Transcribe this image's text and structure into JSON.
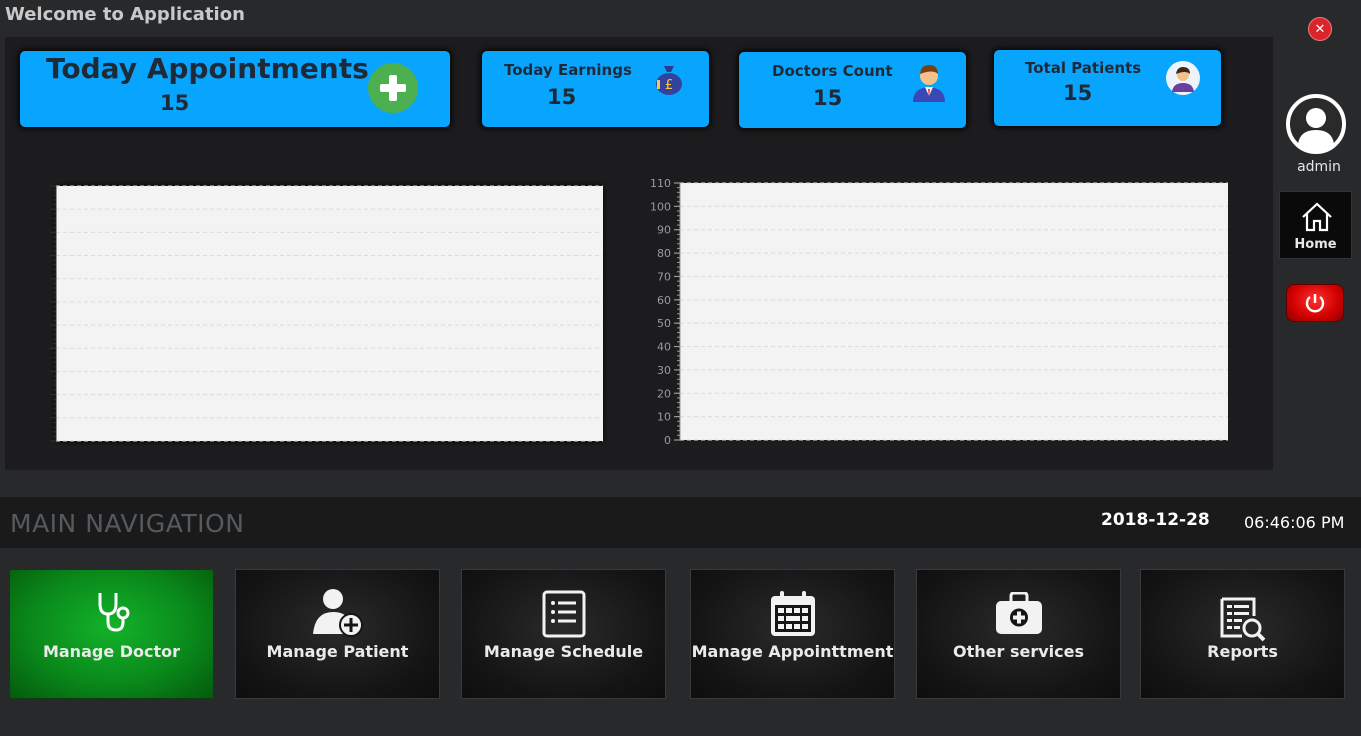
{
  "window": {
    "title": "Welcome to Application"
  },
  "cards": [
    {
      "label": "Today Appointments",
      "value": "15",
      "icon": "add-icon"
    },
    {
      "label": "Today Earnings",
      "value": "15",
      "icon": "money-bag-icon"
    },
    {
      "label": "Doctors Count",
      "value": "15",
      "icon": "doctor-avatar-icon"
    },
    {
      "label": "Total Patients",
      "value": "15",
      "icon": "patient-avatar-icon"
    }
  ],
  "chart_data": [
    {
      "type": "bar",
      "categories": [],
      "values": [],
      "ylim": [
        0,
        110
      ],
      "yticks": [],
      "grid": true
    },
    {
      "type": "bar",
      "categories": [],
      "values": [],
      "ylim": [
        0,
        110
      ],
      "yticks": [
        "0",
        "10",
        "20",
        "30",
        "40",
        "50",
        "60",
        "70",
        "80",
        "90",
        "100",
        "110"
      ],
      "grid": true
    }
  ],
  "user": {
    "name": "admin"
  },
  "sidebar": {
    "home_label": "Home"
  },
  "nav": {
    "title": "MAIN NAVIGATION",
    "date": "2018-12-28",
    "time": "06:46:06 PM",
    "tiles": [
      {
        "label": "Manage Doctor",
        "icon": "stethoscope-icon",
        "active": true
      },
      {
        "label": "Manage Patient",
        "icon": "add-user-icon",
        "active": false
      },
      {
        "label": "Manage Schedule",
        "icon": "list-icon",
        "active": false
      },
      {
        "label": "Manage Appointtment",
        "icon": "calendar-icon",
        "active": false
      },
      {
        "label": "Other services",
        "icon": "first-aid-kit-icon",
        "active": false
      },
      {
        "label": "Reports",
        "icon": "report-search-icon",
        "active": false
      }
    ]
  },
  "colors": {
    "card": "#08a5ff",
    "active_tile": "#0a8a1b",
    "close": "#d9242b",
    "power": "#d00000"
  }
}
